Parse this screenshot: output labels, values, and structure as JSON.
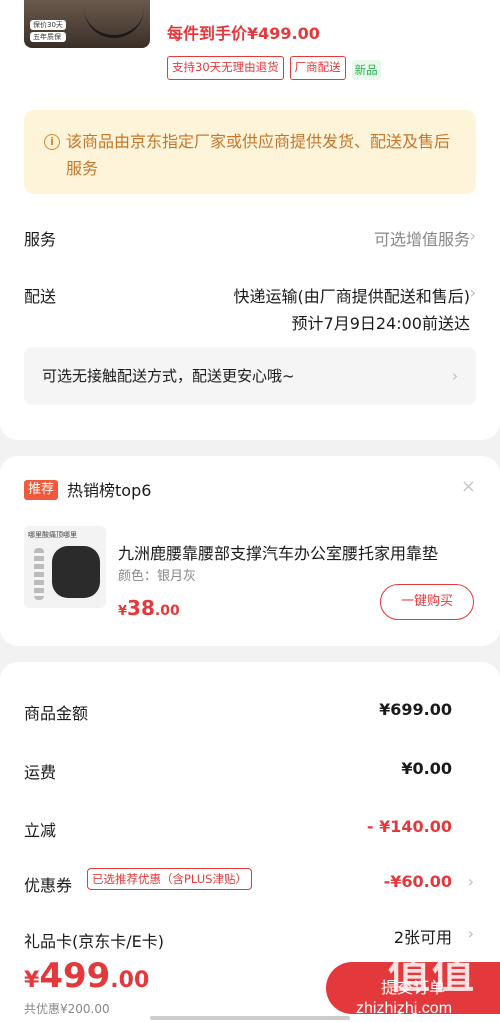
{
  "product": {
    "thumb_tags": [
      "保价30天",
      "五年质保"
    ],
    "price_line": "每件到手价¥499.00",
    "tags": [
      "支持30天无理由退货",
      "厂商配送",
      "新品"
    ]
  },
  "notice": {
    "text": "该商品由京东指定厂家或供应商提供发货、配送及售后服务"
  },
  "service": {
    "label": "服务",
    "value": "可选增值服务"
  },
  "delivery": {
    "label": "配送",
    "method": "快递运输(由厂商提供配送和售后)",
    "eta": "预计7月9日24:00前送达",
    "contactless": "可选无接触配送方式，配送更安心哦~"
  },
  "recommend": {
    "badge": "推荐",
    "title": "热销榜top6",
    "img_caption": "哪里酸痛顶哪里",
    "name": "九洲鹿腰靠腰部支撑汽车办公室腰托家用靠垫",
    "spec": "颜色：银月灰",
    "price_currency": "¥",
    "price_int": "38",
    "price_dec": ".00",
    "buy_label": "一键购买"
  },
  "amounts": {
    "goods_label": "商品金额",
    "goods_value": "¥699.00",
    "shipping_label": "运费",
    "shipping_value": "¥0.00",
    "discount_label": "立减",
    "discount_value": "- ¥140.00",
    "coupon_label": "优惠券",
    "coupon_tag": "已选推荐优惠（含PLUS津贴）",
    "coupon_value": "-¥60.00",
    "giftcard_label": "礼品卡(京东卡/E卡)",
    "giftcard_value": "2张可用"
  },
  "footer": {
    "total_currency": "¥",
    "total_int": "499",
    "total_dec": ".00",
    "saved": "共优惠¥200.00",
    "submit_label": "提交订单"
  },
  "watermark": {
    "big": "值值值",
    "small": "zhizhizhi.com"
  },
  "colors": {
    "accent": "#e4393c",
    "notice_bg": "#fdf4d9",
    "notice_text": "#c7762a",
    "new_tag": "#2eae4f"
  }
}
